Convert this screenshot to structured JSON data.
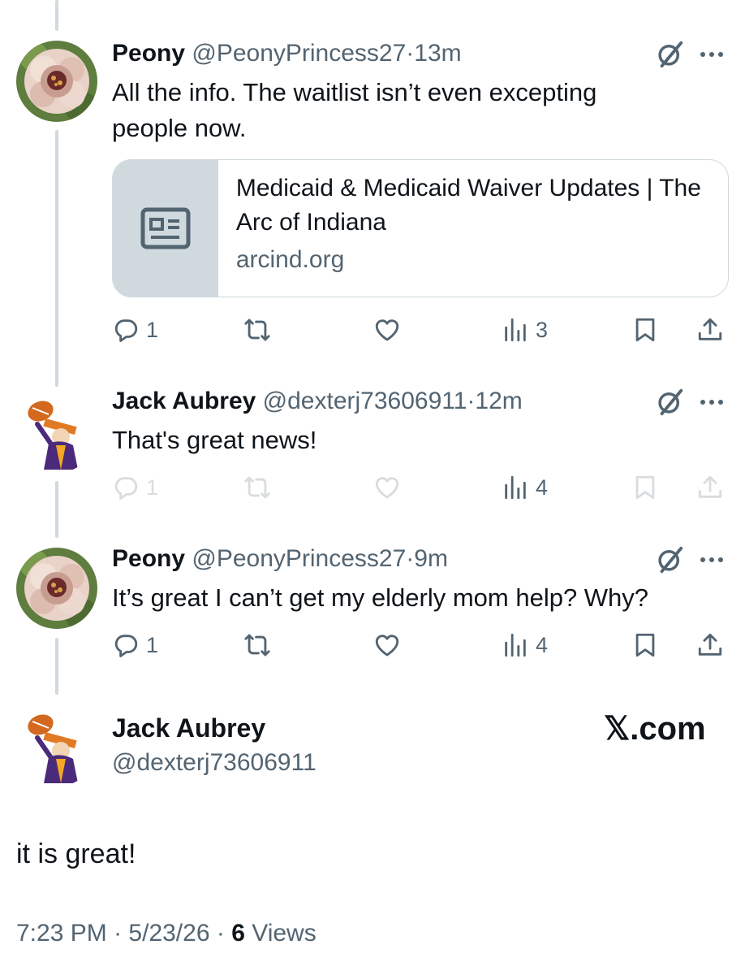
{
  "tweets": [
    {
      "name": "Peony",
      "handle": "@PeonyPrincess27",
      "separator": "·",
      "time": "13m",
      "text": "All the info. The waitlist isn’t even excepting people now.",
      "card": {
        "title": "Medicaid & Medicaid Waiver Updates | The Arc of Indiana",
        "domain": "arcind.org",
        "thumb_icon": "article-icon"
      },
      "replies": "1",
      "views": "3"
    },
    {
      "name": "Jack Aubrey",
      "handle": "@dexterj73606911",
      "separator": "·",
      "time": "12m",
      "text": "That's great news!",
      "replies": "1",
      "views": "4",
      "actions_faded": true
    },
    {
      "name": "Peony",
      "handle": "@PeonyPrincess27",
      "separator": "·",
      "time": "9m",
      "text": "It’s great I can’t get my elderly mom help? Why?",
      "replies": "1",
      "views": "4"
    }
  ],
  "main_tweet": {
    "name": "Jack Aubrey",
    "handle": "@dexterj73606911",
    "watermark": "𝕏.com",
    "text": "it is great!",
    "time": "7:23 PM",
    "separator": "·",
    "date": "5/23/26",
    "views_count": "6",
    "views_label": "Views"
  },
  "icons": {
    "reply": "reply-icon",
    "retweet": "retweet-icon",
    "like": "heart-icon",
    "views": "views-chart-icon",
    "bookmark": "bookmark-icon",
    "share": "share-icon",
    "grok": "grok-icon",
    "more": "more-icon"
  },
  "colors": {
    "text": "#0f1419",
    "secondary": "#536471",
    "border": "#cfd9de"
  }
}
